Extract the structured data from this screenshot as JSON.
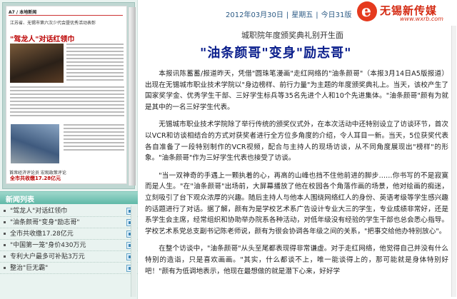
{
  "header": {
    "date": "2012年03月30日",
    "weekday": "星期五",
    "issue": "今日31版",
    "logo_text": "无锡新传媒",
    "logo_url": "www.wxrb.com"
  },
  "thumbnail": {
    "head": "A7 / 本地新闻",
    "subline": "江苏省、无锡市第六次少代会暨优秀活动表彰",
    "title": "\"驾龙人\"对话红领巾",
    "bottom": "首席经济评论员 宏观政策评论",
    "bottom_red": "全市共收缴17.28亿元"
  },
  "news_list": {
    "title": "新闻列表",
    "items": [
      "\"驾龙人\"对话红领巾",
      "\"油条颜哥\"变身\"励志哥\"",
      "全市共收缴17.28亿元",
      "\"中国第一笼\"身价430万元",
      "专利大户最多可补贴3万元",
      "整治\"巨无霸\""
    ]
  },
  "article": {
    "rubric": "城职院年度颁奖典礼别开生面",
    "headline": "\"油条颜哥\"变身\"励志哥\"",
    "paragraphs": [
      "本报讯陈蓄蓄/报道昨天，凭借\"圆珠笔漫画\"走红网络的\"油条颜哥\"（本报3月14日A5版报道）出现在无锡城市职业技术学院以\"身边榜样、前行力量\"为主题的年度颁奖典礼上。当天，该校产生了国家奖学金、优秀学生干部、三好学生标兵等35名先进个人和10个先进集体。\"油条颜哥\"颜有为就是其中的一名三好学生代表。",
      "无锡城市职业技术学院除了举行传统的颁奖仪式外，在本次活动中还特别设立了访谈环节，首次以VCR和访谈相结合的方式对获奖者进行全方位多角度的介绍，令人耳目一新。当天，5位获奖代表各自准备了一段特别制作的VCR视频，配合与主持人的现场访谈，从不同角度展现出\"榜样\"的形象。\"油条颜哥\"作为三好学生代表也接受了访谈。",
      "\"当一双神奇的手遇上一颗执着的心，再高的山峰也挡不住他前进的脚步……你书写的不是寂寞而是人生。\"在\"油条颜哥\"出场前，大屏幕播放了他在校园各个角落作画的场景，他对绘画的痴迷，立刻吸引了台下观众浓厚的兴趣。随后主持人与他本人围绕网络红人的身份、英语考级等学生感兴趣的话题进行了对话。据了解，颜有为是学校艺术系广告设计专业大三的学生，专业成绩非常好，还是系学生会主席，经常组织和协助举办院系各种活动，对低年级没有经验的学生干部也总会悉心指导。学校艺术系党总支副书记陈老师说，颜有为很会协调各年级之间的关系，\"把事交给他办特别放心\"。",
      "在整个访谈中，\"油条颜哥\"从头至尾都表现得非常谦虚。对于走红网络，他觉得自己并没有什么特别的造诣，只是喜欢画画。\"其实，什么都谈不上，唯一能谈得上的，那可能就是身体特别好吧！\"颜有为低调地表示，他现在最想做的就是潜下心来，好好学"
    ]
  }
}
